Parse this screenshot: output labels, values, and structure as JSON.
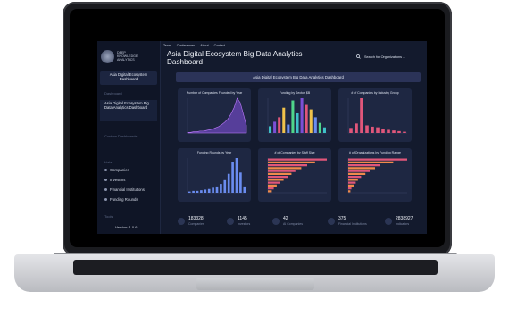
{
  "brand": {
    "line1": "DEEP",
    "line2": "KNOWLEDGE",
    "line3": "ANALYTICS"
  },
  "sidebar": {
    "active_button": "Asia Digital Ecosystem Dashboard",
    "section_dashboard": "Dashboard",
    "selected_item": "Asia Digital Ecosystem Big Data Analytics Dashboard",
    "custom_dashboards": "Custom Dashboards",
    "lists_label": "Lists",
    "items": [
      {
        "label": "Companies",
        "icon": "building-icon"
      },
      {
        "label": "Investors",
        "icon": "person-icon"
      },
      {
        "label": "Financial Institutions",
        "icon": "bank-icon"
      },
      {
        "label": "Funding Rounds",
        "icon": "coins-icon"
      }
    ],
    "tools_label": "Tools",
    "version": "Version: 1.0.6"
  },
  "topnav": [
    "Team",
    "Conferences",
    "About",
    "Contact"
  ],
  "header": {
    "title": "Asia Digital Ecosystem Big Data Analytics Dashboard",
    "search_placeholder": "Search for Organizations ..."
  },
  "banner": "Asia Digital Ecosystem Big Data Analytics Dashboard",
  "cards": [
    {
      "title": "Number of Companies Founded by Year"
    },
    {
      "title": "Funding by Sector, $B"
    },
    {
      "title": "# of Companies by Industry Group"
    },
    {
      "title": "Funding Rounds by Year"
    },
    {
      "title": "# of Companies by Staff Size"
    },
    {
      "title": "# of Organizations by Funding Range"
    }
  ],
  "stats": [
    {
      "value": "183328",
      "label": "Companies"
    },
    {
      "value": "1145",
      "label": "Investors"
    },
    {
      "value": "42",
      "label": "AI Companies"
    },
    {
      "value": "375",
      "label": "Financial Institutions"
    },
    {
      "value": "2838927",
      "label": "Indicators"
    }
  ],
  "colors": {
    "background": "#131a2d",
    "card": "#1e2742",
    "accent_purple": "#7b4fd6",
    "accent_pink": "#e0567a",
    "accent_orange": "#f08a4b",
    "accent_teal": "#3fc1c9"
  },
  "chart_data": [
    {
      "type": "area",
      "title": "Number of Companies Founded by Year",
      "values": [
        1,
        1,
        2,
        2,
        3,
        3,
        4,
        5,
        6,
        8,
        10,
        13,
        17,
        22,
        30,
        40,
        55,
        48,
        30,
        12
      ]
    },
    {
      "type": "bar",
      "title": "Funding by Sector, $B",
      "values": [
        12,
        20,
        28,
        45,
        15,
        58,
        35,
        62,
        50,
        42,
        28,
        18,
        10
      ]
    },
    {
      "type": "bar",
      "title": "# of Companies by Industry Group",
      "values": [
        8,
        15,
        55,
        12,
        10,
        9,
        6,
        5,
        4,
        3,
        2
      ]
    },
    {
      "type": "bar",
      "title": "Funding Rounds by Year",
      "values": [
        2,
        3,
        3,
        4,
        5,
        6,
        8,
        10,
        14,
        20,
        30,
        48,
        55,
        32,
        10
      ]
    },
    {
      "type": "bar",
      "title": "# of Companies by Staff Size",
      "values": [
        60,
        48,
        40,
        34,
        28,
        24,
        20,
        16,
        12,
        9,
        6,
        4
      ]
    },
    {
      "type": "bar",
      "title": "# of Organizations by Funding Range",
      "values": [
        55,
        42,
        30,
        25,
        20,
        16,
        12,
        9,
        7,
        5,
        3,
        2
      ]
    }
  ]
}
